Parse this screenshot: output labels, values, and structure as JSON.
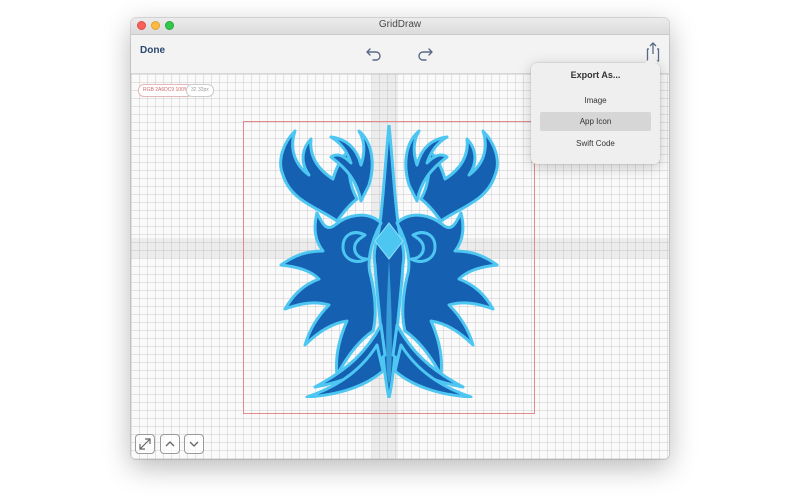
{
  "window": {
    "title": "GridDraw"
  },
  "toolbar": {
    "done_label": "Done",
    "undo_icon": "undo-icon",
    "redo_icon": "redo-icon",
    "share_icon": "share-icon"
  },
  "canvas": {
    "color_pill": "RGB 2A6DC9 100%",
    "size_pill": "32 32px"
  },
  "export_popover": {
    "title": "Export As...",
    "items": [
      {
        "label": "Image",
        "selected": false
      },
      {
        "label": "App Icon",
        "selected": true
      },
      {
        "label": "Swift Code",
        "selected": false
      }
    ]
  },
  "bottom_controls": {
    "resize_icon": "expand-icon",
    "up_icon": "chevron-up-icon",
    "down_icon": "chevron-down-icon"
  },
  "colors": {
    "art_dark_blue": "#1560b0",
    "art_light_blue": "#4ec6f2",
    "accent_text": "#2d4870",
    "artboard_border": "#e58a8a"
  }
}
